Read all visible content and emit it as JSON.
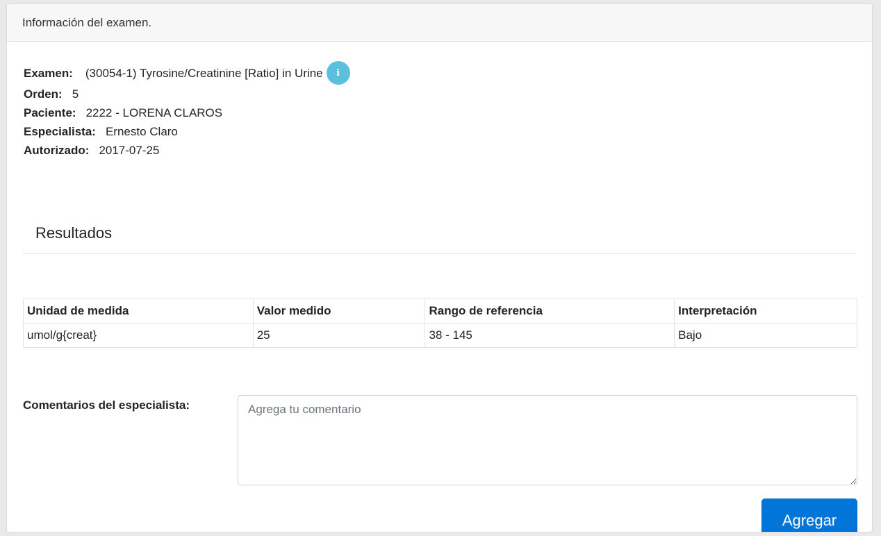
{
  "card": {
    "header_title": "Información del examen."
  },
  "exam_info": {
    "examen": {
      "label": "Examen:",
      "value": "(30054-1) Tyrosine/Creatinine [Ratio] in Urine",
      "icon": "info-icon"
    },
    "orden": {
      "label": "Orden:",
      "value": "5"
    },
    "paciente": {
      "label": "Paciente:",
      "value": "2222 - LORENA CLAROS"
    },
    "especialista": {
      "label": "Especialista:",
      "value": "Ernesto Claro"
    },
    "autorizado": {
      "label": "Autorizado:",
      "value": "2017-07-25"
    }
  },
  "results": {
    "title": "Resultados",
    "columns": [
      "Unidad de medida",
      "Valor medido",
      "Rango de referencia",
      "Interpretación"
    ],
    "rows": [
      [
        "umol/g{creat}",
        "25",
        "38 - 145",
        "Bajo"
      ]
    ]
  },
  "comments": {
    "label": "Comentarios del especialista:",
    "placeholder": "Agrega tu comentario",
    "value": ""
  },
  "actions": {
    "add_label": "Agregar"
  },
  "colors": {
    "info_icon": "#5bc0de",
    "primary_button": "#0275d8",
    "header_bg": "#f7f7f8"
  }
}
